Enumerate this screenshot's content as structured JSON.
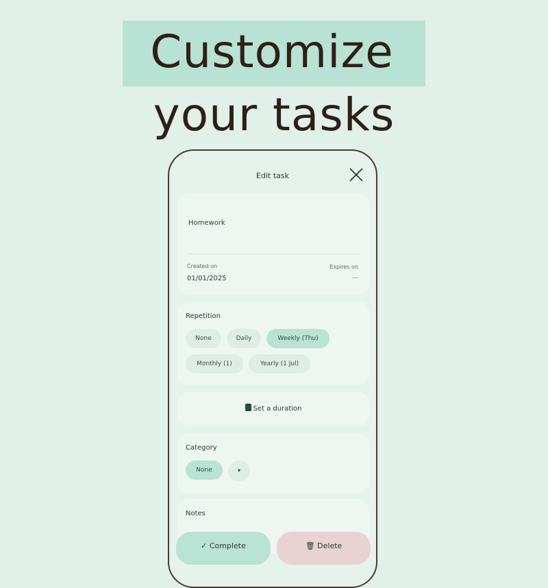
{
  "promo": {
    "headline_line1": "Customize",
    "headline_line2": "your tasks"
  },
  "header": {
    "title": "Edit task",
    "close_icon": "close-x-icon"
  },
  "task": {
    "name": "Homework",
    "created_label": "Created on",
    "created_value": "01/01/2025",
    "expires_label": "Expires on",
    "expires_value": "—"
  },
  "repetition": {
    "label": "Repetition",
    "options": [
      "None",
      "Daily",
      "Weekly (Thu)",
      "Monthly (1)",
      "Yearly (1 Jul)"
    ],
    "selected": "Weekly (Thu)"
  },
  "duration": {
    "label": "Set a duration",
    "icon": "hourglass-icon"
  },
  "category": {
    "label": "Category",
    "selected": "None",
    "dropdown_icon": "▾"
  },
  "notes": {
    "label": "Notes"
  },
  "actions": {
    "complete_label": "✓ Complete",
    "delete_label": "🗑 Delete"
  },
  "colors": {
    "background": "#e2f0ea",
    "accent": "#b9e3d4",
    "danger": "#e8d2d4",
    "text": "#2e2017"
  }
}
